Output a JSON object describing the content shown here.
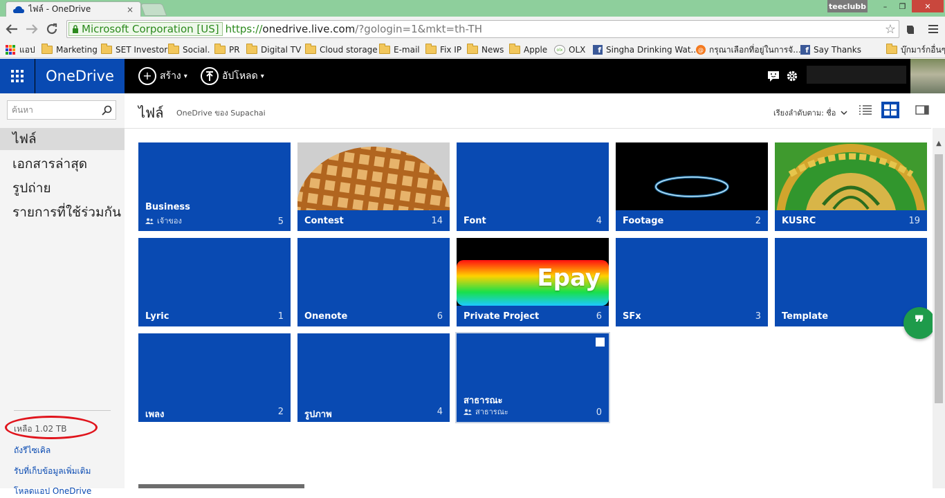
{
  "browser": {
    "tab_title": "ไฟล์ - OneDrive",
    "tab_close": "×",
    "profile_name": "teeclubb",
    "window_controls": {
      "minimize": "–",
      "restore": "❐",
      "close": "✕"
    },
    "ev_cert": "Microsoft Corporation [US]",
    "url_scheme": "https://",
    "url_host": "onedrive.live.com",
    "url_path": "/?gologin=1&mkt=th-TH",
    "bookmarks": {
      "apps": "แอป",
      "items": [
        "Marketing",
        "SET Investor",
        "Social.",
        "PR",
        "Digital TV",
        "Cloud storage",
        "E-mail",
        "Fix IP",
        "News",
        "Apple"
      ],
      "olx": "OLX",
      "singha": "Singha Drinking Wat...",
      "thai_site": "กรุณาเลือกที่อยู่ในการจั...",
      "say_thanks": "Say Thanks",
      "other": "บุ๊กมาร์กอื่นๆ"
    }
  },
  "header": {
    "brand": "OneDrive",
    "create_label": "สร้าง",
    "upload_label": "อัปโหลด"
  },
  "sidebar": {
    "search_placeholder": "ค้นหา",
    "items": [
      "ไฟล์",
      "เอกสารล่าสุด",
      "รูปถ่าย",
      "รายการที่ใช้ร่วมกัน"
    ],
    "quota": "เหลือ 1.02 TB",
    "recycle_bin": "ถังรีไซเคิล",
    "more_storage": "รับที่เก็บข้อมูลเพิ่มเติม",
    "get_apps": "โหลดแอป OneDrive"
  },
  "main": {
    "title": "ไฟล์",
    "subtitle": "OneDrive ของ Supachai",
    "sort_label": "เรียงลำดับตาม: ชื่อ",
    "tiles": [
      {
        "name": "Business",
        "count": "5",
        "sub": "เจ้าของ"
      },
      {
        "name": "Contest",
        "count": "14"
      },
      {
        "name": "Font",
        "count": "4"
      },
      {
        "name": "Footage",
        "count": "2"
      },
      {
        "name": "KUSRC",
        "count": "19"
      },
      {
        "name": "Lyric",
        "count": "1"
      },
      {
        "name": "Onenote",
        "count": "6"
      },
      {
        "name": "Private Project",
        "count": "6",
        "thumb_text": "Epay"
      },
      {
        "name": "SFx",
        "count": "3"
      },
      {
        "name": "Template",
        "count": ""
      },
      {
        "name": "เพลง",
        "count": "2"
      },
      {
        "name": "รูปภาพ",
        "count": "4"
      },
      {
        "name": "สาธารณะ",
        "count": "0",
        "sub": "สาธารณะ"
      }
    ],
    "feedback_glyph": "❞"
  },
  "colors": {
    "onedrive_blue": "#094ab2",
    "chrome_title_green": "#8ecf9c",
    "feedback_green": "#1e9b4b",
    "annotation_red": "#e0141c"
  }
}
